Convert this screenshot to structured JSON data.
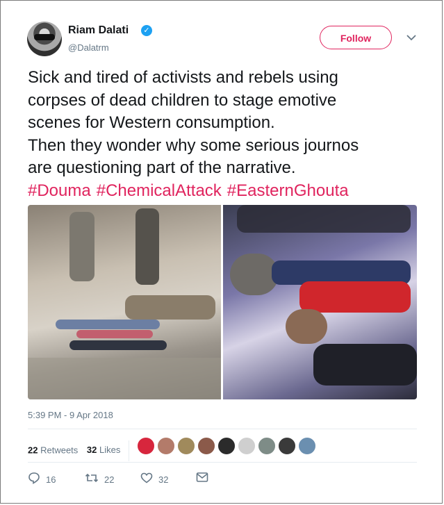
{
  "tweet": {
    "author": {
      "name": "Riam Dalati",
      "handle": "@Dalatrm",
      "verified": true
    },
    "follow_label": "Follow",
    "text_lines": [
      "Sick and tired of activists and rebels using",
      "corpses of dead children to stage emotive",
      "scenes for Western consumption.",
      "Then they wonder why some serious journos",
      "are questioning part of the narrative."
    ],
    "hashtags": [
      "#Douma",
      "#ChemicalAttack",
      "#EasternGhouta"
    ],
    "timestamp": "5:39 PM - 9 Apr 2018",
    "stats": {
      "retweets_count": "22",
      "retweets_label": "Retweets",
      "likes_count": "32",
      "likes_label": "Likes"
    },
    "likers": [
      "#d7263d",
      "#b37b6a",
      "#a08a5c",
      "#8b5a4a",
      "#2b2b2b",
      "#cfcfcf",
      "#7e8c87",
      "#3a3a3a",
      "#6b8fb0"
    ],
    "actions": {
      "reply_count": "16",
      "retweet_count": "22",
      "like_count": "32"
    },
    "colors": {
      "accent": "#e0245e",
      "muted": "#657786",
      "verified": "#1da1f2"
    }
  }
}
